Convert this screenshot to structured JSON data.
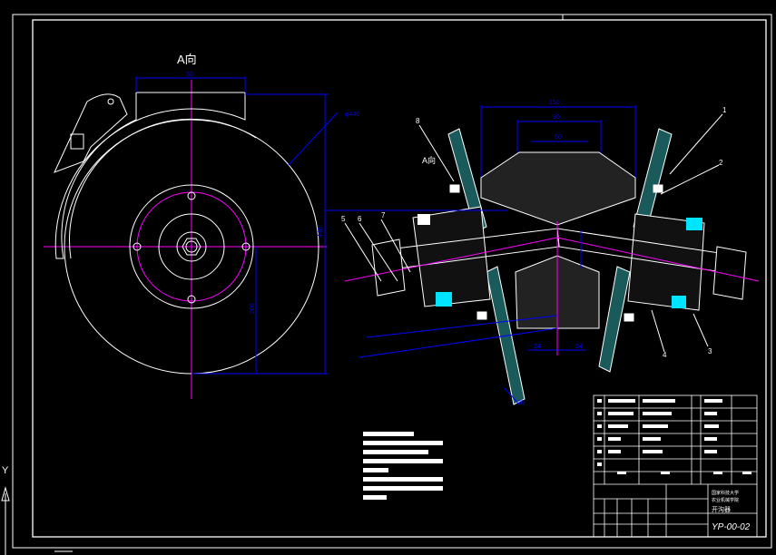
{
  "drawing": {
    "view_label": "A向",
    "section_marker": "A向",
    "drawing_number": "YP-00-02",
    "part_title": "开沟器",
    "school_line1": "国家科技大学",
    "school_line2": "农业机械学院"
  },
  "colors": {
    "background": "#000000",
    "outline": "#ffffff",
    "dimension": "#0000ff",
    "centerline": "#ff00ff",
    "hatch": "#00ffff",
    "leader": "#ffffff",
    "cyan_fill": "#00e5ff"
  },
  "dimensions": {
    "left_top": "50",
    "left_diameter": "φ440",
    "left_radius": "R40",
    "left_vertical": "440",
    "left_height": "200",
    "right_outer": "150",
    "right_mid": "90",
    "right_inner": "60",
    "angle_left": "24",
    "angle_right": "24",
    "bottom_gap": "20"
  },
  "part_callouts": [
    "1",
    "2",
    "3",
    "4",
    "5",
    "6",
    "7",
    "8"
  ]
}
